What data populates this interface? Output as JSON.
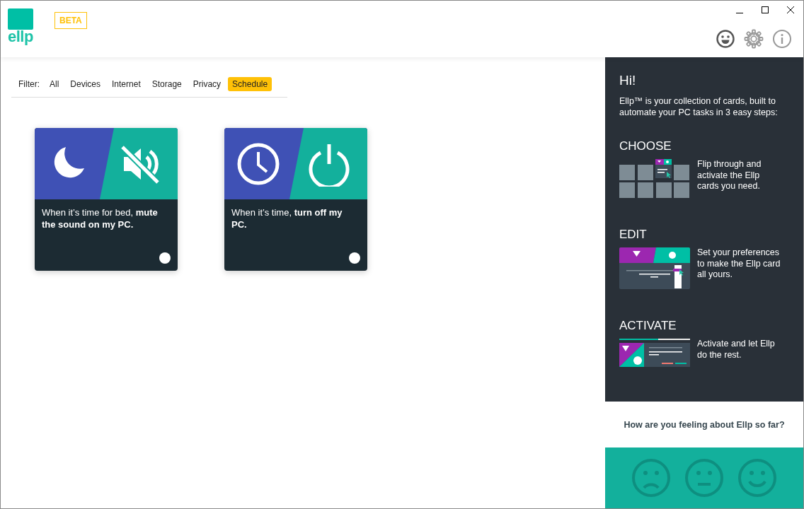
{
  "app": {
    "logo": "ellp",
    "badge": "BETA"
  },
  "filter": {
    "label": "Filter:",
    "options": [
      {
        "label": "All",
        "selected": false
      },
      {
        "label": "Devices",
        "selected": false
      },
      {
        "label": "Internet",
        "selected": false
      },
      {
        "label": "Storage",
        "selected": false
      },
      {
        "label": "Privacy",
        "selected": false
      },
      {
        "label": "Schedule",
        "selected": true
      }
    ]
  },
  "cards": [
    {
      "icons": [
        {
          "kind": "moon"
        },
        {
          "kind": "mute"
        }
      ],
      "text": "When it’s time for bed, **mute the sound on my PC.**",
      "active": false
    },
    {
      "icons": [
        {
          "kind": "clock"
        },
        {
          "kind": "power"
        }
      ],
      "text": "When it’s time, **turn off my PC.**",
      "active": false
    }
  ],
  "panel": {
    "title": "Hi!",
    "intro": "Ellp™ is your collection of cards, built to automate your PC tasks in 3 easy steps:",
    "steps": [
      {
        "kind": "choose",
        "title": "CHOOSE",
        "text": "Flip through and activate the Ellp cards you need."
      },
      {
        "kind": "edit",
        "title": "EDIT",
        "text": "Set your preferences to make the Ellp card all yours."
      },
      {
        "kind": "activate",
        "title": "ACTIVATE",
        "text": "Activate and let Ellp do the rest."
      }
    ],
    "feedback": {
      "question": "How are you feeling about Ellp so far?",
      "faces": [
        {
          "kind": "sad"
        },
        {
          "kind": "neutral"
        },
        {
          "kind": "happy"
        }
      ]
    }
  }
}
